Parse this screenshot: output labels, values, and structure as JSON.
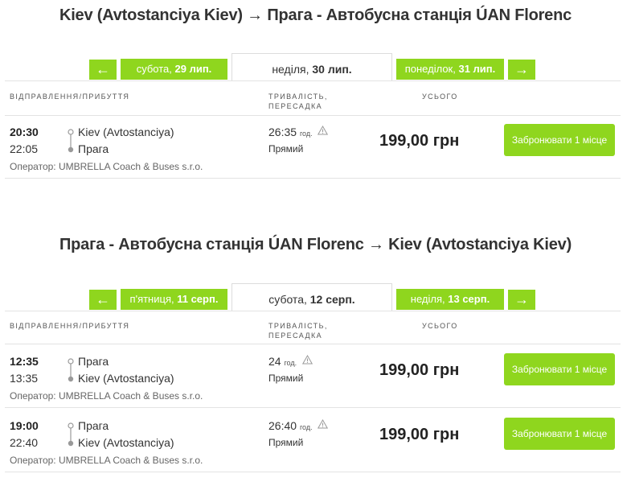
{
  "outbound": {
    "title": "Kiev (Avtostanciya Kiev) → Прага - Автобусна станція ÚAN Florenc",
    "prev_day": {
      "weekday": "субота, ",
      "date": "29 лип."
    },
    "current_day": {
      "weekday": "неділя, ",
      "date": "30 лип."
    },
    "next_day": {
      "weekday": "понеділок, ",
      "date": "31 лип."
    },
    "trips": [
      {
        "departure": "20:30",
        "arrival": "22:05",
        "from": "Kiev (Avtostanciya)",
        "to": "Прага",
        "operator": "Оператор: UMBRELLA Coach & Buses s.r.o.",
        "duration": "26:35",
        "duration_unit": "год.",
        "transfer": "Прямий",
        "price": "199,00 грн",
        "book_label": "Забронювати 1 місце"
      }
    ]
  },
  "return": {
    "title": "Прага - Автобусна станція ÚAN Florenc → Kiev (Avtostanciya Kiev)",
    "prev_day": {
      "weekday": "п'ятниця, ",
      "date": "11 серп."
    },
    "current_day": {
      "weekday": "субота, ",
      "date": "12 серп."
    },
    "next_day": {
      "weekday": "неділя, ",
      "date": "13 серп."
    },
    "trips": [
      {
        "departure": "12:35",
        "arrival": "13:35",
        "from": "Прага",
        "to": "Kiev (Avtostanciya)",
        "operator": "Оператор: UMBRELLA Coach & Buses s.r.o.",
        "duration": "24",
        "duration_unit": "год.",
        "transfer": "Прямий",
        "price": "199,00 грн",
        "book_label": "Забронювати 1 місце"
      },
      {
        "departure": "19:00",
        "arrival": "22:40",
        "from": "Прага",
        "to": "Kiev (Avtostanciya)",
        "operator": "Оператор: UMBRELLA Coach & Buses s.r.o.",
        "duration": "26:40",
        "duration_unit": "год.",
        "transfer": "Прямий",
        "price": "199,00 грн",
        "book_label": "Забронювати 1 місце"
      }
    ]
  },
  "columns": {
    "departure_arrival": "Відправлення/прибуття",
    "duration_line1": "Тривалість,",
    "duration_line2": "пересадка",
    "total": "Усього"
  },
  "nav": {
    "prev_arrow": "←",
    "next_arrow": "→"
  },
  "icons": {
    "warning": "warning-icon",
    "route": "route-line-icon"
  },
  "colors": {
    "accent": "#8fd61e",
    "text": "#333333",
    "divider": "#e3e3e3"
  }
}
